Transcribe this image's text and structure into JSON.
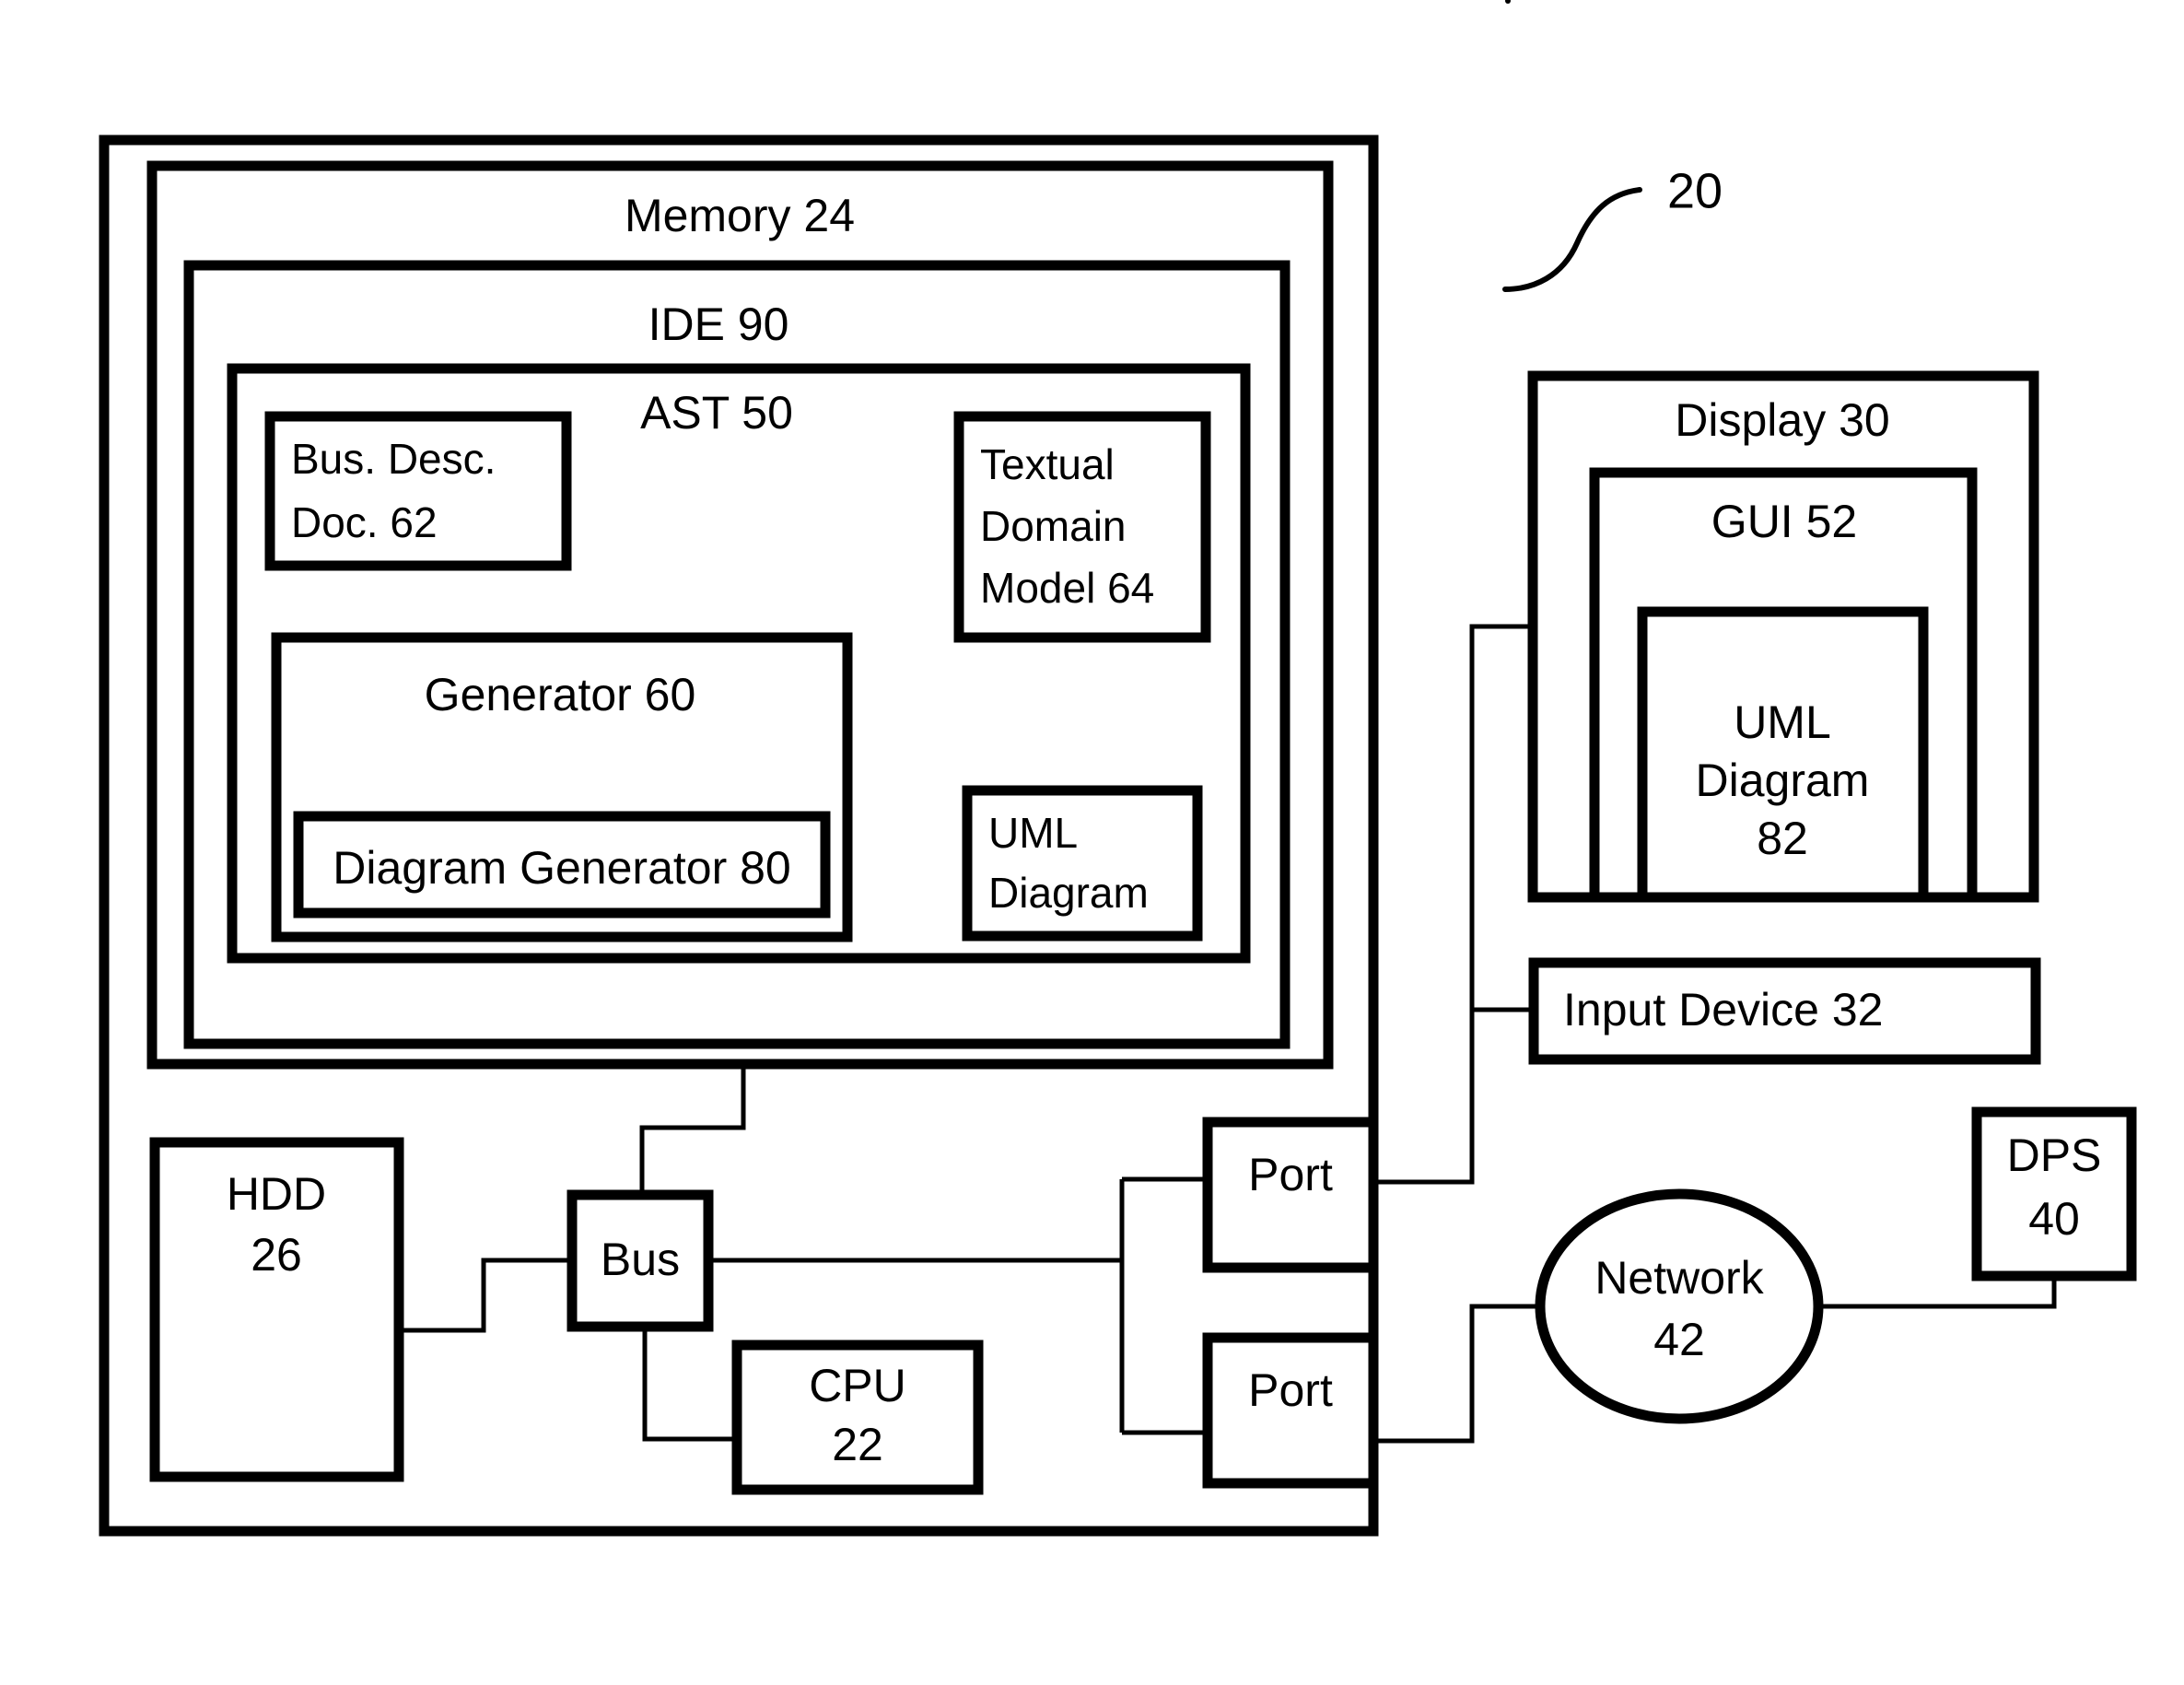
{
  "figure": {
    "reference_numeral": "20",
    "background_color": "#ffffff",
    "line_color": "#000000"
  },
  "computer": {
    "memory": {
      "label": "Memory 24",
      "ide": {
        "label": "IDE 90",
        "ast": {
          "label": "AST 50",
          "components": [
            {
              "id": "bus-desc-doc",
              "line1": "Bus. Desc.",
              "line2": "Doc. 62"
            },
            {
              "id": "textual-domain-model",
              "line1": "Textual",
              "line2": "Domain",
              "line3": "Model 64"
            },
            {
              "id": "generator",
              "label": "Generator 60",
              "child": {
                "id": "diagram-generator",
                "label": "Diagram Generator 80"
              }
            },
            {
              "id": "uml-diagram-internal",
              "line1": "UML",
              "line2": "Diagram"
            }
          ]
        }
      }
    },
    "hdd": {
      "line1": "HDD",
      "line2": "26"
    },
    "bus": {
      "label": "Bus"
    },
    "cpu": {
      "line1": "CPU",
      "line2": "22"
    },
    "ports": [
      {
        "id": "port-upper",
        "label": "Port"
      },
      {
        "id": "port-lower",
        "label": "Port"
      }
    ]
  },
  "peripherals": {
    "display": {
      "label": "Display 30",
      "gui": {
        "label": "GUI 52",
        "uml_diagram": {
          "line1": "UML",
          "line2": "Diagram",
          "line3": "82"
        }
      }
    },
    "input_device": {
      "label": "Input Device 32"
    }
  },
  "external": {
    "network": {
      "line1": "Network",
      "line2": "42"
    },
    "dps": {
      "line1": "DPS",
      "line2": "40"
    }
  }
}
